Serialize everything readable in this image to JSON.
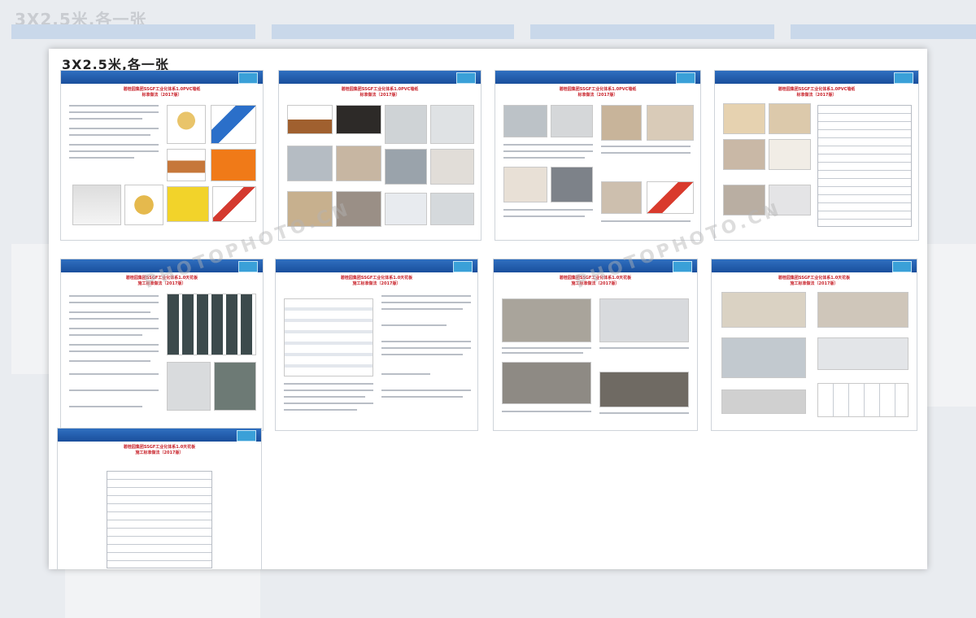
{
  "background_title": "3X2.5米,各一张",
  "canvas_title": "3X2.5米,各一张",
  "watermark": "PHOTOPHOTO.CN",
  "pages": [
    {
      "title_line1": "碧桂园集团SSGF工业化体系1.0PVC墙纸",
      "title_line2": "标准做法（2017版）"
    },
    {
      "title_line1": "碧桂园集团SSGF工业化体系1.0PVC墙纸",
      "title_line2": "标准做法（2017版）"
    },
    {
      "title_line1": "碧桂园集团SSGF工业化体系1.0PVC墙纸",
      "title_line2": "标准做法（2017版）"
    },
    {
      "title_line1": "碧桂园集团SSGF工业化体系1.0PVC墙纸",
      "title_line2": "标准做法（2017版）"
    },
    {
      "title_line1": "碧桂园集团SSGF工业化体系1.0天花板",
      "title_line2": "施工标准做法（2017版）"
    },
    {
      "title_line1": "碧桂园集团SSGF工业化体系1.0天花板",
      "title_line2": "施工标准做法（2017版）"
    },
    {
      "title_line1": "碧桂园集团SSGF工业化体系1.0天花板",
      "title_line2": "施工标准做法（2017版）"
    },
    {
      "title_line1": "碧桂园集团SSGF工业化体系1.0天花板",
      "title_line2": "施工标准做法（2017版）"
    },
    {
      "title_line1": "碧桂园集团SSGF工业化体系1.0天花板",
      "title_line2": "施工标准做法（2017版）"
    }
  ]
}
